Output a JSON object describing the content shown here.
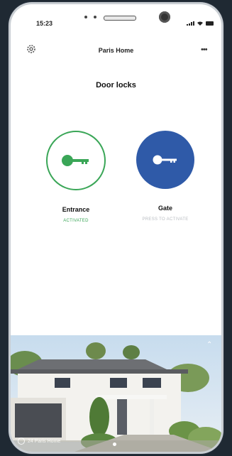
{
  "status_bar": {
    "time": "15:23"
  },
  "header": {
    "home_name": "Paris Home",
    "more_label": "•••"
  },
  "page": {
    "title": "Door locks"
  },
  "locks": [
    {
      "name": "Entrance",
      "status": "ACTIVATED",
      "state": "active",
      "color": "#3aa657"
    },
    {
      "name": "Gate",
      "status": "PRESS TO ACTIVATE",
      "state": "idle",
      "color": "#2f5aa8"
    }
  ],
  "photo": {
    "caption": "24 Paris Home",
    "icon": "clock-icon"
  },
  "colors": {
    "accent_green": "#3aa657",
    "accent_blue": "#2f5aa8",
    "background": "#1f2933"
  }
}
